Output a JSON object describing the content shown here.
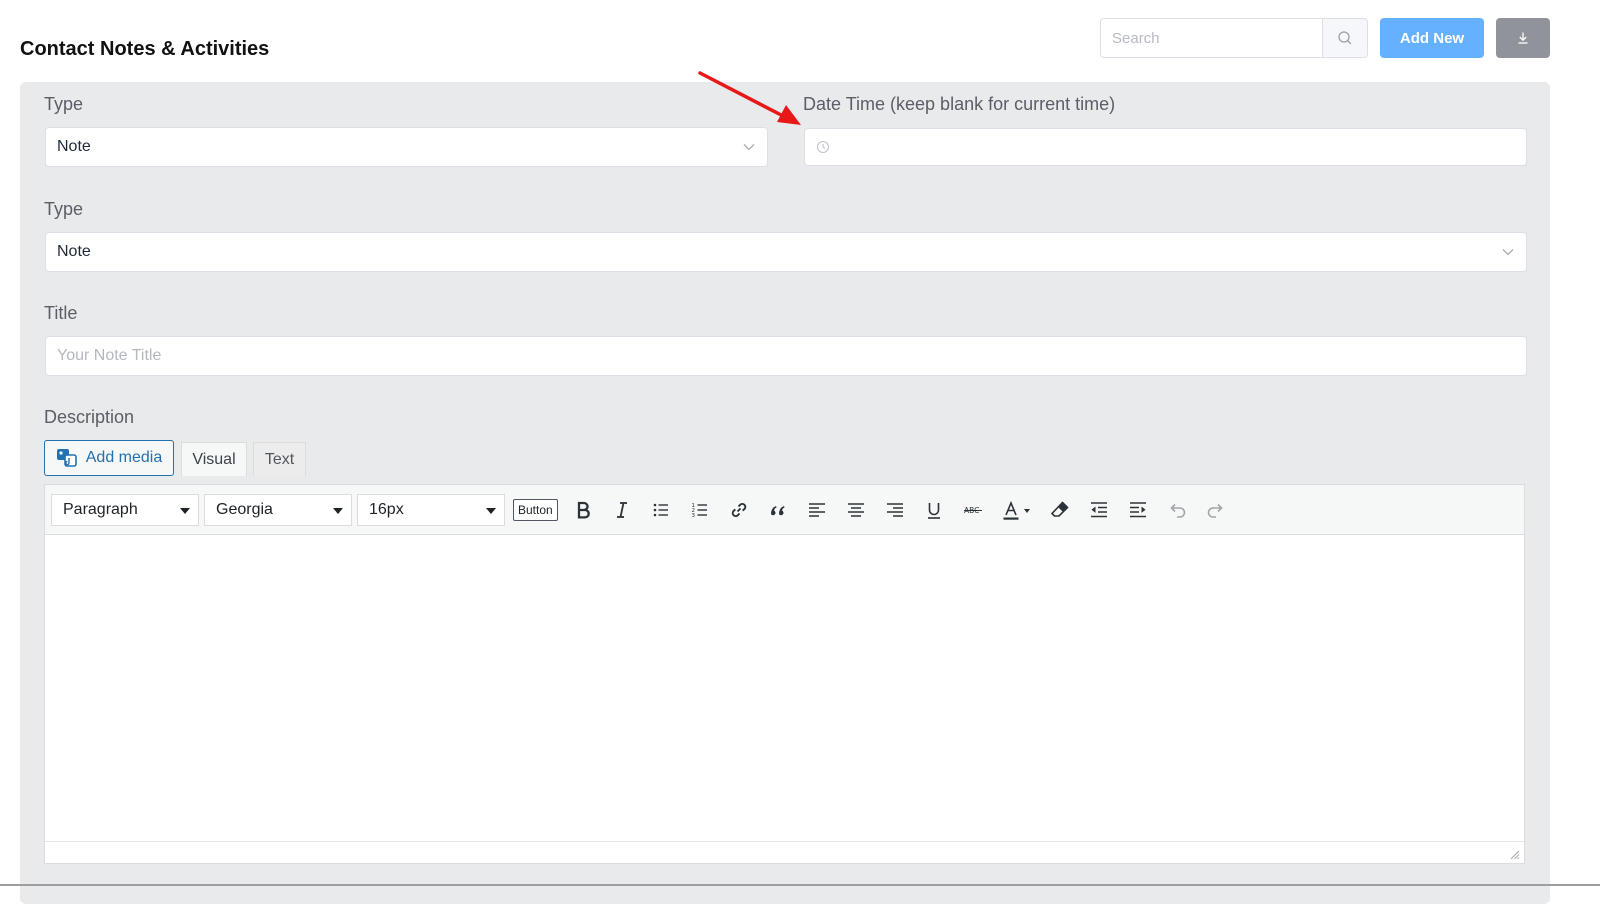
{
  "header": {
    "title": "Contact Notes & Activities",
    "search_placeholder": "Search",
    "add_new_label": "Add New"
  },
  "form": {
    "type_label": "Type",
    "type_value": "Note",
    "datetime_label": "Date Time (keep blank for current time)",
    "type2_label": "Type",
    "type2_value": "Note",
    "title_label": "Title",
    "title_placeholder": "Your Note Title",
    "description_label": "Description"
  },
  "editor": {
    "add_media_label": "Add media",
    "tabs": [
      {
        "label": "Visual"
      },
      {
        "label": "Text"
      }
    ],
    "format_select": "Paragraph",
    "font_select": "Georgia",
    "size_select": "16px",
    "button_label": "Button"
  },
  "colors": {
    "accent_blue": "#66b1ff",
    "panel_bg": "#e9eaec",
    "download_btn": "#909399",
    "annotation_arrow": "#e81818",
    "wp_blue": "#2271b1"
  },
  "icons": [
    "search-icon",
    "download-icon",
    "chevron-down-icon",
    "clock-icon",
    "add-media-icon",
    "bold-icon",
    "italic-icon",
    "bullet-list-icon",
    "numbered-list-icon",
    "link-icon",
    "blockquote-icon",
    "align-left-icon",
    "align-center-icon",
    "align-right-icon",
    "underline-icon",
    "strikethrough-icon",
    "text-color-icon",
    "clear-formatting-icon",
    "outdent-icon",
    "indent-icon",
    "undo-icon",
    "redo-icon",
    "resize-handle-icon",
    "annotation-arrow"
  ]
}
